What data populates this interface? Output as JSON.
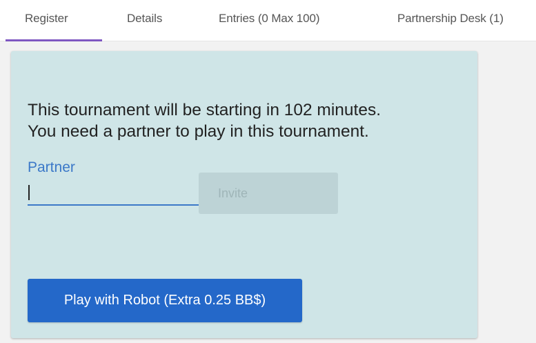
{
  "tabs": [
    {
      "label": "Register"
    },
    {
      "label": "Details"
    },
    {
      "label": "Entries (0 Max 100)"
    },
    {
      "label": "Partnership Desk (1)"
    }
  ],
  "register": {
    "message_line1": "This tournament will be starting in 102 minutes.",
    "message_line2": "You need a partner to play in this tournament.",
    "partner_label": "Partner",
    "partner_value": "",
    "invite_label": "Invite",
    "robot_button_label": "Play with Robot (Extra 0.25 BB$)"
  },
  "colors": {
    "tab_indicator": "#7e57c2",
    "card_background": "#cfe5e7",
    "field_accent": "#3b78c8",
    "robot_button": "#2468c9"
  }
}
